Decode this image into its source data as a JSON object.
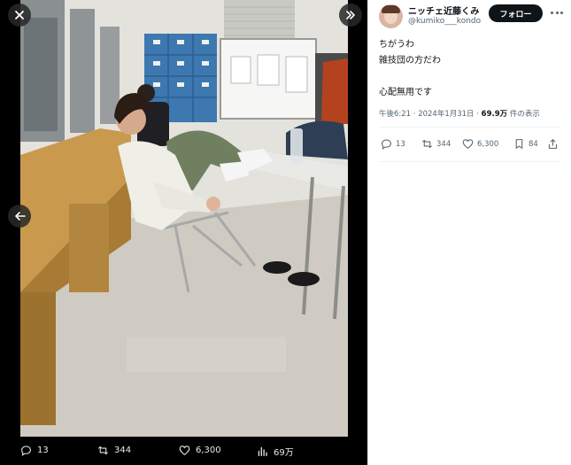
{
  "media_stats": {
    "replies": "13",
    "retweets": "344",
    "likes": "6,300",
    "views": "69万"
  },
  "tweet": {
    "author_name": "ニッチェ近藤くみ",
    "author_handle": "@kumiko___kondo",
    "follow_label": "フォロー",
    "lines": [
      "ちがうわ",
      "雑技団の方だわ",
      "",
      "心配無用です"
    ],
    "time": "午後6:21 · 2024年1月31日 · ",
    "views_count": "69.9万",
    "views_suffix": " 件の表示",
    "stats": {
      "replies": "13",
      "retweets": "344",
      "likes": "6,300",
      "bookmarks": "84"
    }
  },
  "colors": {
    "follow_bg": "#0f1419",
    "secondary_text": "#536471"
  },
  "icons": [
    "close-icon",
    "expand-icon",
    "back-arrow-icon",
    "reply-icon",
    "retweet-icon",
    "like-icon",
    "views-icon",
    "bookmark-icon",
    "share-icon",
    "more-icon"
  ]
}
